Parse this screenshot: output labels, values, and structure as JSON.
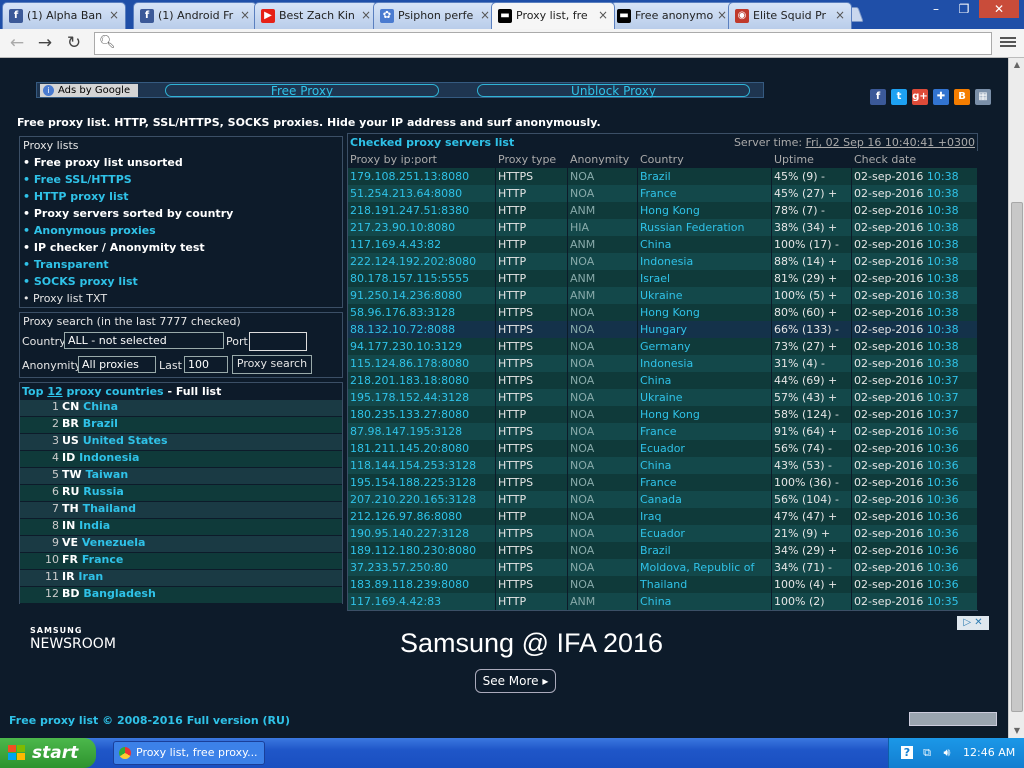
{
  "browser": {
    "tabs": [
      {
        "title": "(1) Alpha Ban",
        "icon": "facebook-icon",
        "color": "#3b5998",
        "glyph": "f"
      },
      {
        "title": "(1) Android Fr",
        "icon": "facebook-icon",
        "color": "#3b5998",
        "glyph": "f"
      },
      {
        "title": "Best Zach Kin",
        "icon": "youtube-icon",
        "color": "#e62117",
        "glyph": "▶"
      },
      {
        "title": "Psiphon perfe",
        "icon": "psiphon-icon",
        "color": "#4a7bd0",
        "glyph": "✿"
      },
      {
        "title": "Proxy list, fre",
        "icon": "proxy-site-icon",
        "color": "#000000",
        "glyph": "▬",
        "active": true
      },
      {
        "title": "Free anonymo",
        "icon": "proxy-site-icon",
        "color": "#000000",
        "glyph": "▬"
      },
      {
        "title": "Elite Squid Pr",
        "icon": "squid-icon",
        "color": "#c0392b",
        "glyph": "◉"
      }
    ],
    "address_value": "",
    "window_buttons": [
      "–",
      "❐",
      "✕"
    ]
  },
  "ads": {
    "ads_by_google": "Ads by Google",
    "link1": "Free Proxy",
    "link2": "Unblock Proxy"
  },
  "social_icons": [
    {
      "name": "facebook-share-icon",
      "color": "#3b5998",
      "glyph": "f"
    },
    {
      "name": "twitter-share-icon",
      "color": "#1da1f2",
      "glyph": "t"
    },
    {
      "name": "google-plus-share-icon",
      "color": "#dd4b39",
      "glyph": "g+"
    },
    {
      "name": "delicious-share-icon",
      "color": "#3274d1",
      "glyph": "✚"
    },
    {
      "name": "blogger-share-icon",
      "color": "#f57d00",
      "glyph": "B"
    },
    {
      "name": "bookmark-share-icon",
      "color": "#7a8fa8",
      "glyph": "▦"
    }
  ],
  "tagline": "Free proxy list. HTTP, SSL/HTTPS, SOCKS proxies. Hide your IP address and surf anonymously.",
  "proxy_lists": {
    "heading": "Proxy lists",
    "items": [
      {
        "label": "• Free proxy list unsorted",
        "style": "white"
      },
      {
        "label": "• Free SSL/HTTPS",
        "style": "cyan"
      },
      {
        "label": "• HTTP proxy list",
        "style": "cyan"
      },
      {
        "label": "• Proxy servers sorted by country",
        "style": "white"
      },
      {
        "label": "• Anonymous proxies",
        "style": "cyan"
      },
      {
        "label": "• IP checker / Anonymity test",
        "style": "white"
      },
      {
        "label": "• Transparent",
        "style": "cyan"
      },
      {
        "label": "• SOCKS proxy list",
        "style": "cyan"
      },
      {
        "label": "• Proxy list TXT",
        "style": "plain"
      }
    ]
  },
  "search": {
    "heading": "Proxy search (in the last 7777 checked)",
    "country_label": "Country",
    "country_value": "ALL - not selected",
    "port_label": "Port",
    "port_value": "",
    "anonymity_label": "Anonymity",
    "anonymity_value": "All proxies",
    "last_label": "Last",
    "last_value": "100",
    "button": "Proxy search"
  },
  "top_countries": {
    "prefix": "Top ",
    "count": "12",
    "suffix": " proxy countries",
    "dash": " - ",
    "full_list": "Full list",
    "rows": [
      {
        "n": "1",
        "code": "CN",
        "name": "China"
      },
      {
        "n": "2",
        "code": "BR",
        "name": "Brazil"
      },
      {
        "n": "3",
        "code": "US",
        "name": "United States"
      },
      {
        "n": "4",
        "code": "ID",
        "name": "Indonesia"
      },
      {
        "n": "5",
        "code": "TW",
        "name": "Taiwan"
      },
      {
        "n": "6",
        "code": "RU",
        "name": "Russia"
      },
      {
        "n": "7",
        "code": "TH",
        "name": "Thailand"
      },
      {
        "n": "8",
        "code": "IN",
        "name": "India"
      },
      {
        "n": "9",
        "code": "VE",
        "name": "Venezuela"
      },
      {
        "n": "10",
        "code": "FR",
        "name": "France"
      },
      {
        "n": "11",
        "code": "IR",
        "name": "Iran"
      },
      {
        "n": "12",
        "code": "BD",
        "name": "Bangladesh"
      }
    ]
  },
  "proxy_table": {
    "title": "Checked proxy servers list",
    "server_time_label": "Server time: ",
    "server_time": "Fri, 02 Sep 16 10:40:41 +0300",
    "headers": [
      "Proxy by ip:port",
      "Proxy type",
      "Anonymity",
      "Country",
      "Uptime",
      "Check date"
    ],
    "rows": [
      [
        "179.108.251.13:8080",
        "HTTPS",
        "NOA",
        "Brazil",
        "45% (9) -",
        "02-sep-2016",
        "10:38"
      ],
      [
        "51.254.213.64:8080",
        "HTTP",
        "NOA",
        "France",
        "45% (27) +",
        "02-sep-2016",
        "10:38"
      ],
      [
        "218.191.247.51:8380",
        "HTTP",
        "ANM",
        "Hong Kong",
        "78% (7) -",
        "02-sep-2016",
        "10:38"
      ],
      [
        "217.23.90.10:8080",
        "HTTP",
        "HIA",
        "Russian Federation",
        "38% (34) +",
        "02-sep-2016",
        "10:38"
      ],
      [
        "117.169.4.43:82",
        "HTTP",
        "ANM",
        "China",
        "100% (17) -",
        "02-sep-2016",
        "10:38"
      ],
      [
        "222.124.192.202:8080",
        "HTTP",
        "NOA",
        "Indonesia",
        "88% (14) +",
        "02-sep-2016",
        "10:38"
      ],
      [
        "80.178.157.115:5555",
        "HTTP",
        "ANM",
        "Israel",
        "81% (29) +",
        "02-sep-2016",
        "10:38"
      ],
      [
        "91.250.14.236:8080",
        "HTTP",
        "ANM",
        "Ukraine",
        "100% (5) +",
        "02-sep-2016",
        "10:38"
      ],
      [
        "58.96.176.83:3128",
        "HTTPS",
        "NOA",
        "Hong Kong",
        "80% (60) +",
        "02-sep-2016",
        "10:38"
      ],
      [
        "88.132.10.72:8088",
        "HTTPS",
        "NOA",
        "Hungary",
        "66% (133) -",
        "02-sep-2016",
        "10:38"
      ],
      [
        "94.177.230.10:3129",
        "HTTPS",
        "NOA",
        "Germany",
        "73% (27) +",
        "02-sep-2016",
        "10:38"
      ],
      [
        "115.124.86.178:8080",
        "HTTPS",
        "NOA",
        "Indonesia",
        "31% (4) -",
        "02-sep-2016",
        "10:38"
      ],
      [
        "218.201.183.18:8080",
        "HTTPS",
        "NOA",
        "China",
        "44% (69) +",
        "02-sep-2016",
        "10:37"
      ],
      [
        "195.178.152.44:3128",
        "HTTPS",
        "NOA",
        "Ukraine",
        "57% (43) +",
        "02-sep-2016",
        "10:37"
      ],
      [
        "180.235.133.27:8080",
        "HTTP",
        "NOA",
        "Hong Kong",
        "58% (124) -",
        "02-sep-2016",
        "10:37"
      ],
      [
        "87.98.147.195:3128",
        "HTTPS",
        "NOA",
        "France",
        "91% (64) +",
        "02-sep-2016",
        "10:36"
      ],
      [
        "181.211.145.20:8080",
        "HTTPS",
        "NOA",
        "Ecuador",
        "56% (74) -",
        "02-sep-2016",
        "10:36"
      ],
      [
        "118.144.154.253:3128",
        "HTTPS",
        "NOA",
        "China",
        "43% (53) -",
        "02-sep-2016",
        "10:36"
      ],
      [
        "195.154.188.225:3128",
        "HTTPS",
        "NOA",
        "France",
        "100% (36) -",
        "02-sep-2016",
        "10:36"
      ],
      [
        "207.210.220.165:3128",
        "HTTP",
        "NOA",
        "Canada",
        "56% (104) -",
        "02-sep-2016",
        "10:36"
      ],
      [
        "212.126.97.86:8080",
        "HTTP",
        "NOA",
        "Iraq",
        "47% (47) +",
        "02-sep-2016",
        "10:36"
      ],
      [
        "190.95.140.227:3128",
        "HTTPS",
        "NOA",
        "Ecuador",
        "21% (9) +",
        "02-sep-2016",
        "10:36"
      ],
      [
        "189.112.180.230:8080",
        "HTTPS",
        "NOA",
        "Brazil",
        "34% (29) +",
        "02-sep-2016",
        "10:36"
      ],
      [
        "37.233.57.250:80",
        "HTTPS",
        "NOA",
        "Moldova, Republic of",
        "34% (71) -",
        "02-sep-2016",
        "10:36"
      ],
      [
        "183.89.118.239:8080",
        "HTTPS",
        "NOA",
        "Thailand",
        "100% (4) +",
        "02-sep-2016",
        "10:36"
      ],
      [
        "117.169.4.42:83",
        "HTTP",
        "ANM",
        "China",
        "100% (2)",
        "02-sep-2016",
        "10:35"
      ]
    ]
  },
  "samsung_ad": {
    "brand": "SAMSUNG",
    "brand2": "NEWSROOM",
    "headline": "Samsung @ IFA 2016",
    "button": "See More ▸"
  },
  "footer": {
    "copyright": "Free proxy list © 2008-2016",
    "full_version": "Full version (RU)"
  },
  "taskbar": {
    "start": "start",
    "item": "Proxy list, free proxy...",
    "clock": "12:46 AM"
  },
  "colors": {
    "page_bg": "#0d1b2a",
    "accent_cyan": "#2fc2e8",
    "row_dark": "#0f3a3a",
    "row_light": "#13484a",
    "row_blue": "#183a57"
  }
}
